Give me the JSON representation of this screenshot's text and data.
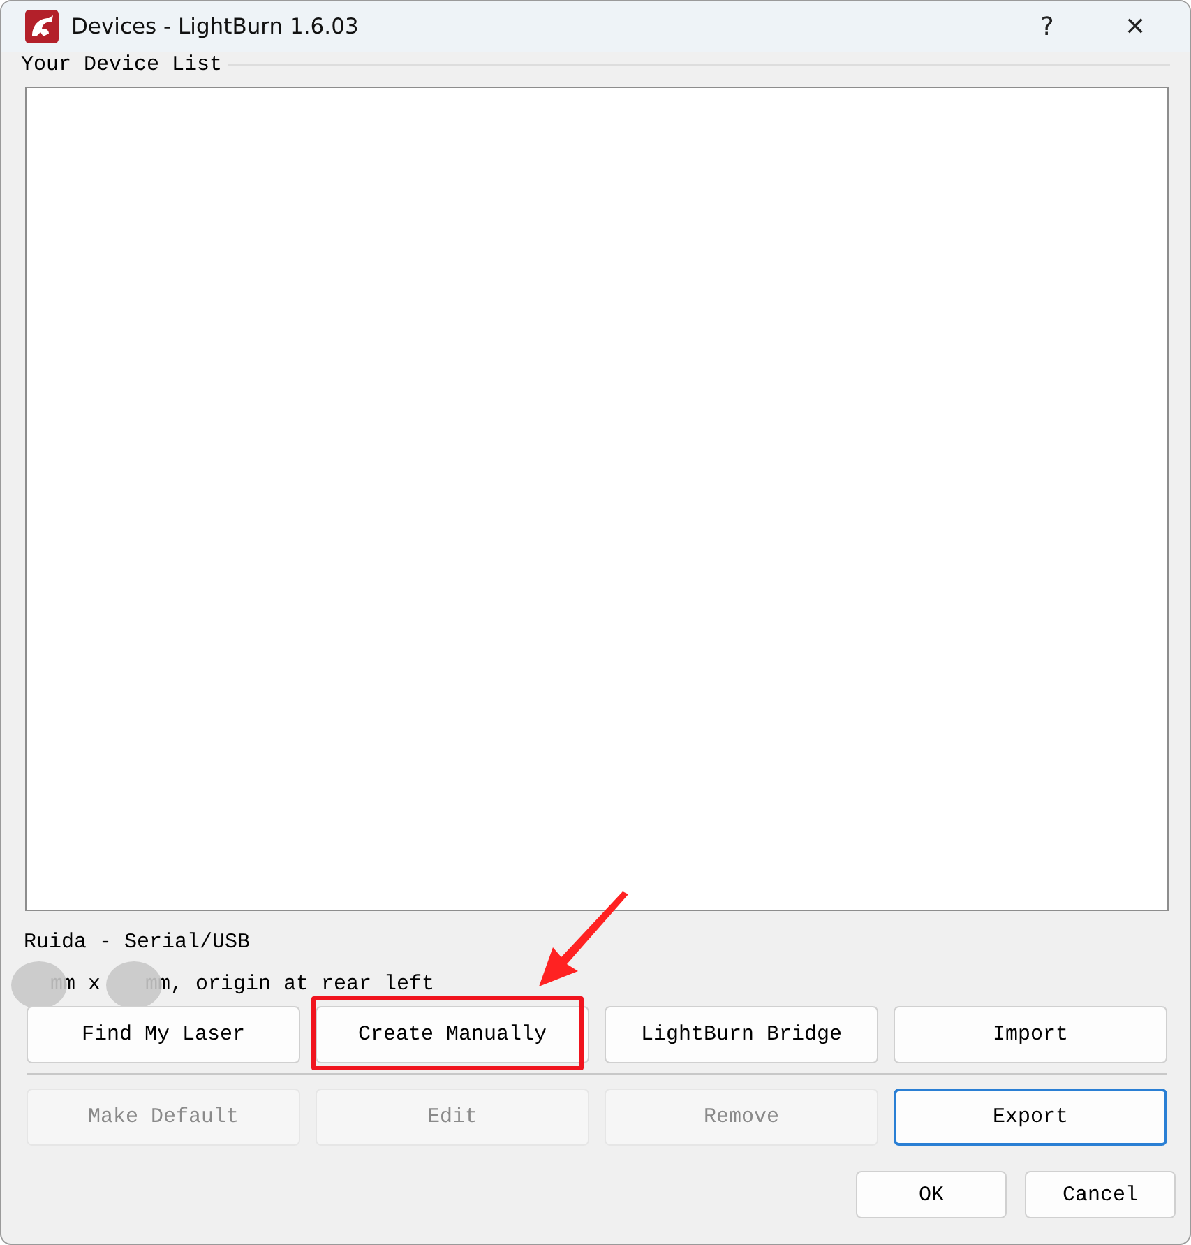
{
  "window": {
    "title": "Devices - LightBurn 1.6.03",
    "help": "?",
    "close": "✕"
  },
  "device_list": {
    "label": "Your Device List"
  },
  "device_name": "Ruida - Serial/USB",
  "device_info": [
    {
      "kind": "redacted"
    },
    {
      "kind": "text",
      "text": "mm x"
    },
    {
      "kind": "redacted"
    },
    {
      "kind": "text",
      "text": "mm, origin at rear left"
    }
  ],
  "button_rows": [
    [
      {
        "label": "Find My Laser",
        "disabled": false,
        "default": false,
        "highlighted": false
      },
      {
        "label": "Create Manually",
        "disabled": false,
        "default": false,
        "highlighted": true
      },
      {
        "label": "LightBurn Bridge",
        "disabled": false,
        "default": false,
        "highlighted": false
      },
      {
        "label": "Import",
        "disabled": false,
        "default": false,
        "highlighted": false
      }
    ],
    [
      {
        "label": "Make Default",
        "disabled": true,
        "default": false,
        "highlighted": false
      },
      {
        "label": "Edit",
        "disabled": true,
        "default": false,
        "highlighted": false
      },
      {
        "label": "Remove",
        "disabled": true,
        "default": false,
        "highlighted": false
      },
      {
        "label": "Export",
        "disabled": false,
        "default": true,
        "highlighted": false
      }
    ]
  ],
  "callout_arrow": true,
  "dialog_buttons": [
    "OK",
    "Cancel"
  ]
}
